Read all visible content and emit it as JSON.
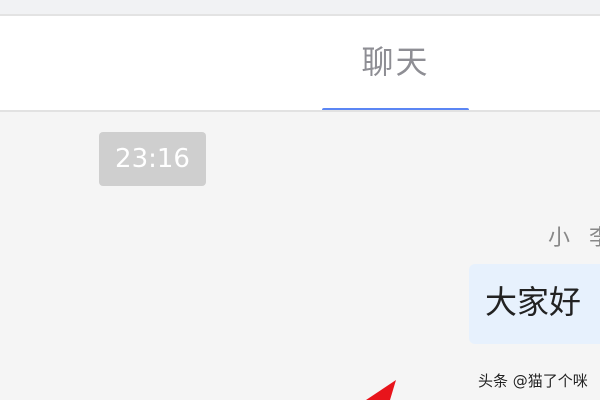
{
  "tabs": [
    {
      "label": "聊天",
      "active": true
    }
  ],
  "chat": {
    "timestamp": "23:16",
    "message": {
      "sender": "小 李",
      "text": "大家好"
    }
  },
  "watermark": "头条 @猫了个咪",
  "colors": {
    "tab_indicator": "#5b86f4",
    "bubble_background": "#e7f1fd",
    "timestamp_chip": "#cfcfcf",
    "arrow": "#e8141b"
  },
  "icons": {
    "annotation": "red-arrow-icon"
  }
}
